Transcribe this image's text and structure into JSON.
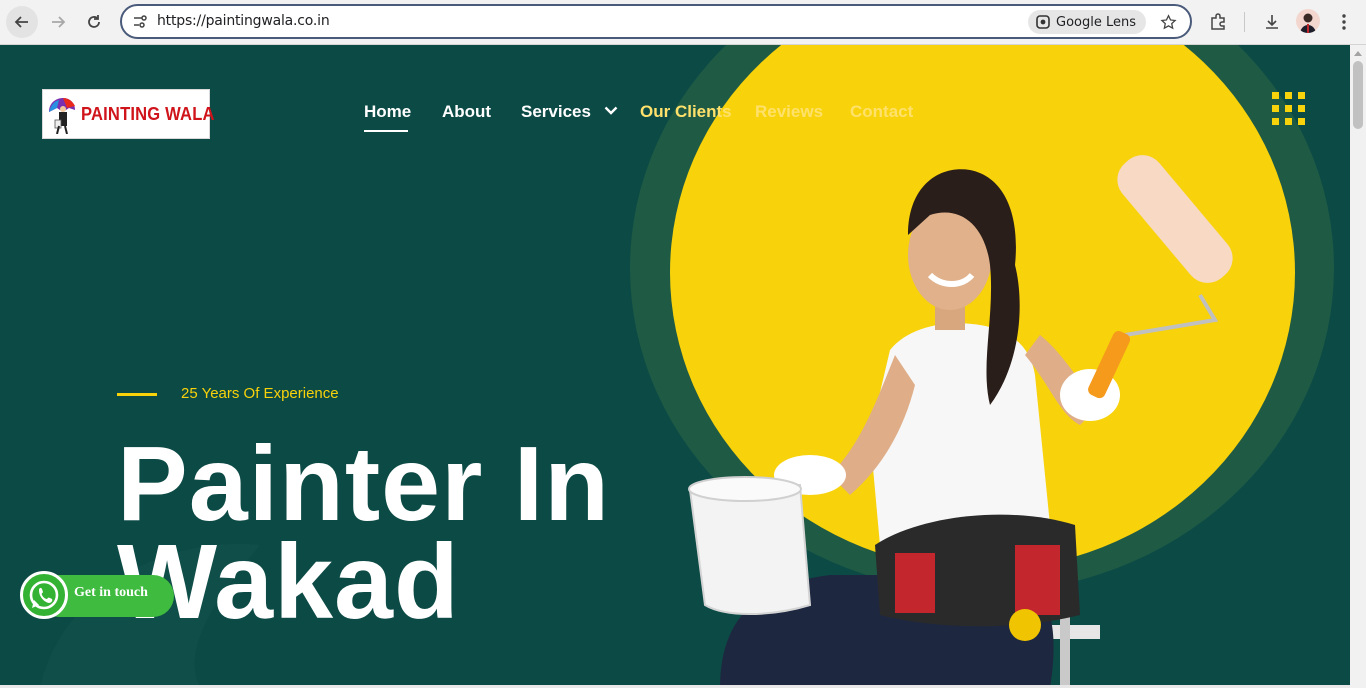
{
  "browser": {
    "url": "https://paintingwala.co.in",
    "lens_label": "Google Lens",
    "icons": [
      "back-arrow-icon",
      "forward-arrow-icon",
      "reload-icon",
      "site-info-icon",
      "google-lens-icon",
      "bookmark-star-icon",
      "extensions-icon",
      "download-icon",
      "profile-avatar",
      "kebab-menu-icon"
    ]
  },
  "site": {
    "logo_text": "PAINTING WALA",
    "nav": {
      "home": "Home",
      "about": "About",
      "services": "Services",
      "clients": "Our Clients",
      "reviews": "Reviews",
      "contact": "Contact"
    },
    "hero": {
      "tagline": "25 Years Of Experience",
      "title_line1": "Painter In",
      "title_line2": "Wakad"
    },
    "whatsapp": {
      "label": "Get in touch"
    }
  },
  "colors": {
    "page_background": "#0c4a45",
    "accent_yellow": "#f8d20b",
    "ring_green": "#1f5a45",
    "logo_red": "#d0141b",
    "whatsapp_green": "#3fbb3f"
  }
}
